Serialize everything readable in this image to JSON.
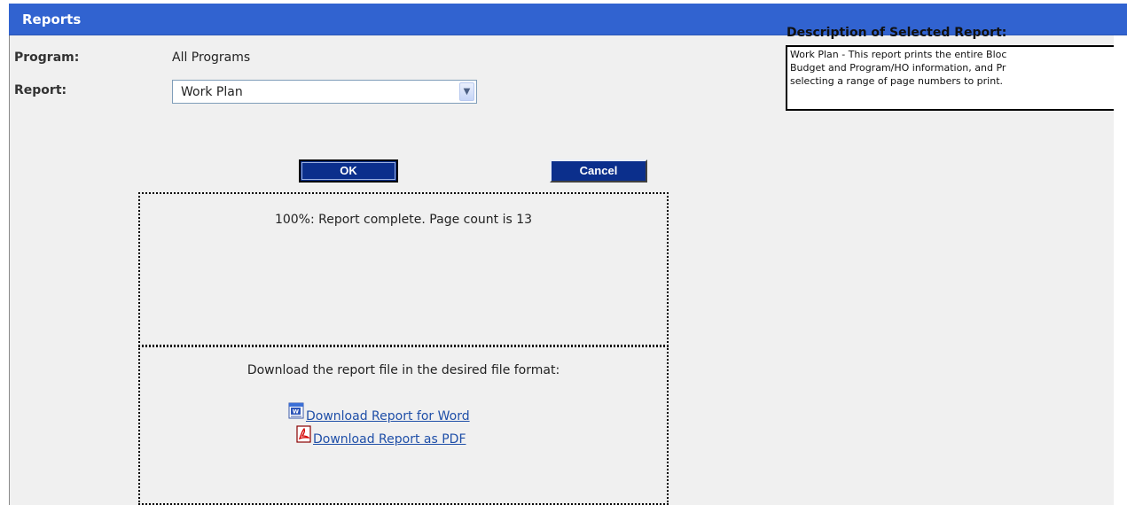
{
  "header": {
    "title": "Reports"
  },
  "form": {
    "program_label": "Program:",
    "program_value": "All Programs",
    "report_label": "Report:",
    "report_selected": "Work Plan"
  },
  "buttons": {
    "ok_label": "OK",
    "cancel_label": "Cancel"
  },
  "status": {
    "message": "100%: Report complete. Page count is 13"
  },
  "download": {
    "prompt": "Download the report file in the desired file format:",
    "word_link": "Download Report for Word",
    "pdf_link": "Download Report as PDF"
  },
  "description": {
    "title": "Description of Selected Report:",
    "text": "Work Plan - This report prints the entire Bloc\nBudget and Program/HO information, and Pr\nselecting a range of page numbers to print."
  },
  "colors": {
    "title_bar": "#3163d0",
    "button": "#0b2f8c",
    "panel": "#f0f0f0",
    "link": "#1f4fa8"
  },
  "icons": {
    "word": "word-doc-icon",
    "pdf": "pdf-icon",
    "dropdown": "chevron-down-icon"
  }
}
